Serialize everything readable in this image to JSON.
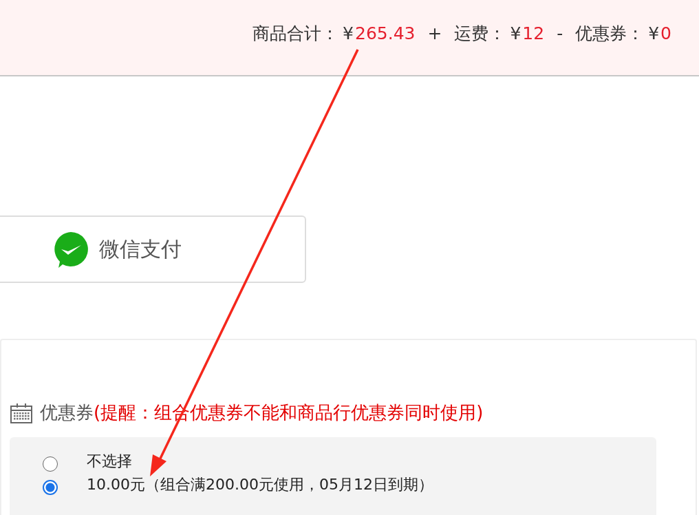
{
  "price_summary": [
    {
      "kind": "term",
      "label": "商品合计：",
      "currency": "¥",
      "amount": "265.43"
    },
    {
      "kind": "operator",
      "text": "+"
    },
    {
      "kind": "term",
      "label": "运费：",
      "currency": "¥",
      "amount": "12"
    },
    {
      "kind": "operator",
      "text": "-"
    },
    {
      "kind": "term",
      "label": "优惠券：",
      "currency": "¥",
      "amount": "0"
    }
  ],
  "payment_method": {
    "label": "微信支付"
  },
  "coupons": {
    "title": "优惠券",
    "reminder": "(提醒：组合优惠券不能和商品行优惠券同时使用)",
    "options": [
      {
        "label": "不选择",
        "selected": false
      },
      {
        "label": "10.00元（组合满200.00元使用，05月12日到期）",
        "selected": true
      }
    ]
  },
  "annotation": {
    "kind": "arrow"
  }
}
